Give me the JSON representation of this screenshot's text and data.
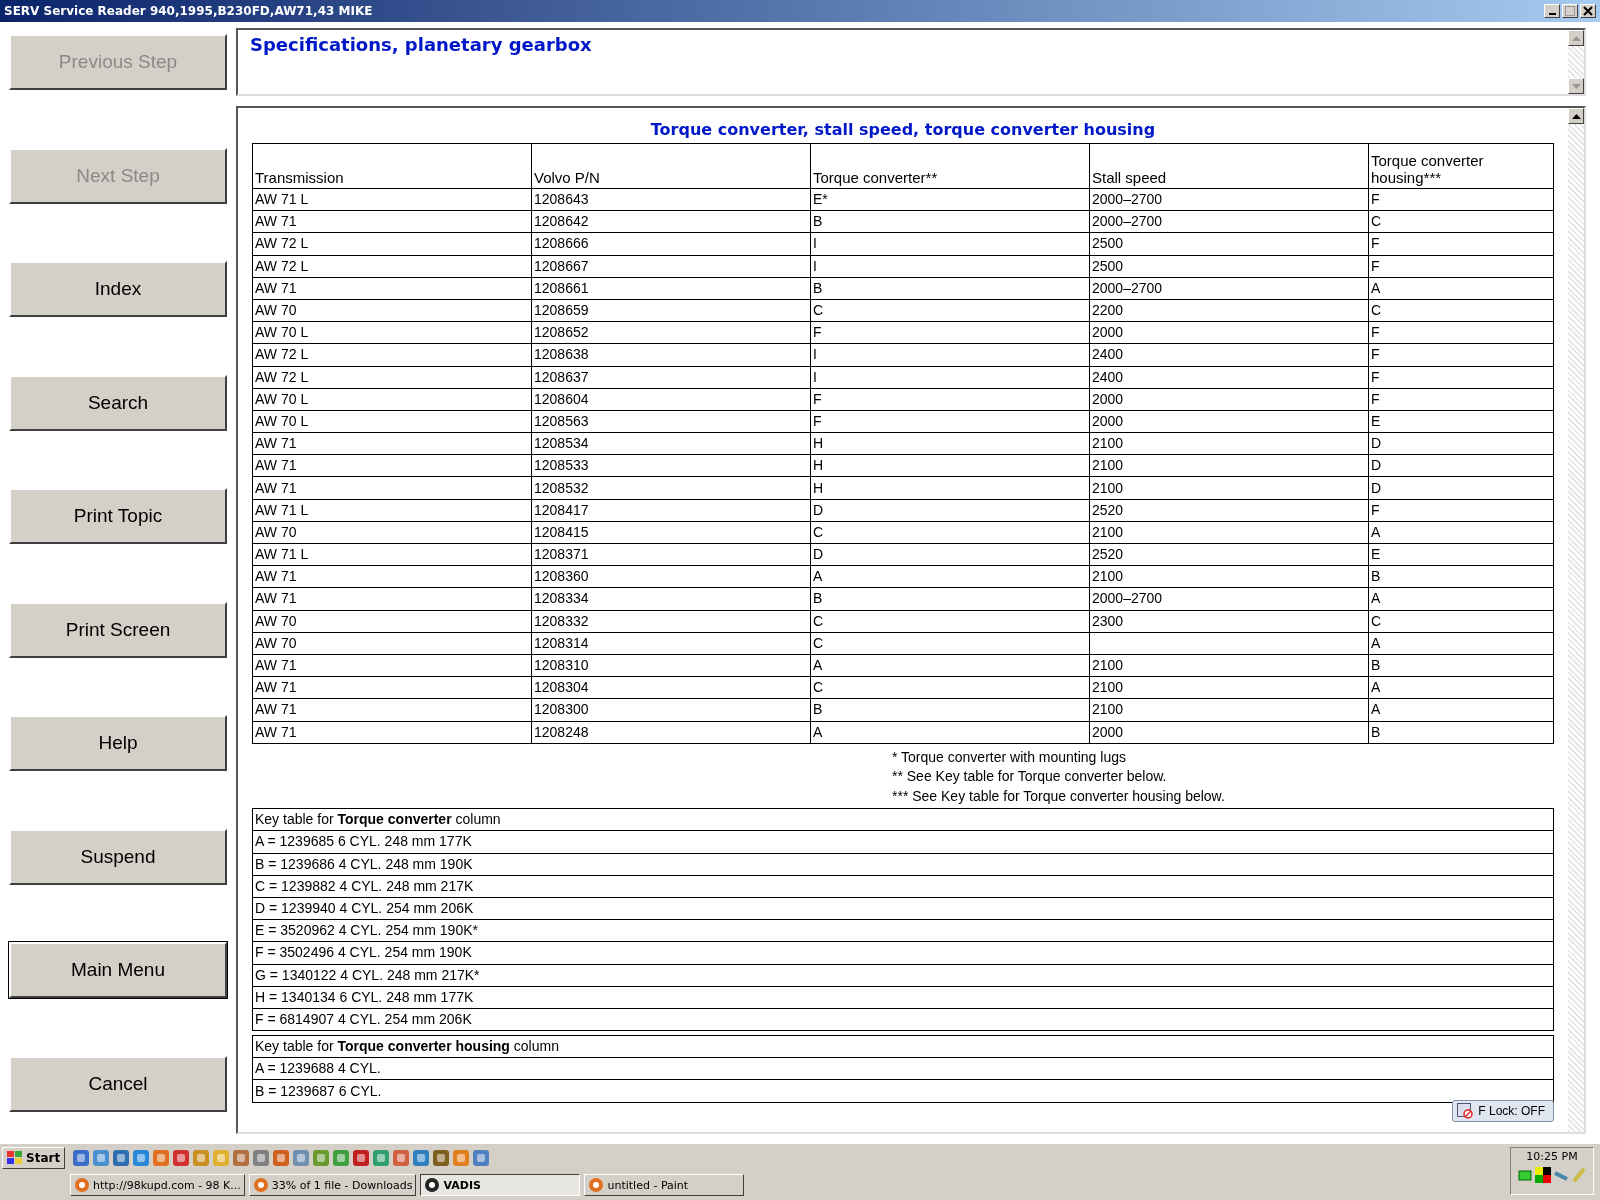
{
  "window": {
    "title": "SERV Service Reader 940,1995,B230FD,AW71,43 MIKE"
  },
  "sidebar": {
    "buttons": [
      {
        "label": "Previous Step",
        "disabled": true,
        "focused": false
      },
      {
        "label": "Next Step",
        "disabled": true,
        "focused": false
      },
      {
        "label": "Index",
        "disabled": false,
        "focused": false
      },
      {
        "label": "Search",
        "disabled": false,
        "focused": false
      },
      {
        "label": "Print Topic",
        "disabled": false,
        "focused": false
      },
      {
        "label": "Print Screen",
        "disabled": false,
        "focused": false
      },
      {
        "label": "Help",
        "disabled": false,
        "focused": false
      },
      {
        "label": "Suspend",
        "disabled": false,
        "focused": false
      },
      {
        "label": "Main Menu",
        "disabled": false,
        "focused": true
      },
      {
        "label": "Cancel",
        "disabled": false,
        "focused": false
      }
    ]
  },
  "topic": {
    "title": "Specifications, planetary gearbox"
  },
  "table": {
    "title": "Torque converter, stall speed, torque converter housing",
    "columns": [
      "Transmission",
      "Volvo P/N",
      "Torque converter**",
      "Stall speed",
      "Torque converter housing***"
    ],
    "rows": [
      [
        "AW 71 L",
        "1208643",
        "E*",
        "2000–2700",
        "F"
      ],
      [
        "AW 71",
        "1208642",
        "B",
        "2000–2700",
        "C"
      ],
      [
        "AW 72 L",
        "1208666",
        "I",
        "2500",
        "F"
      ],
      [
        "AW 72 L",
        "1208667",
        "I",
        "2500",
        "F"
      ],
      [
        "AW 71",
        "1208661",
        "B",
        "2000–2700",
        "A"
      ],
      [
        "AW 70",
        "1208659",
        "C",
        "2200",
        "C"
      ],
      [
        "AW 70 L",
        "1208652",
        "F",
        "2000",
        "F"
      ],
      [
        "AW 72 L",
        "1208638",
        "I",
        "2400",
        "F"
      ],
      [
        "AW 72 L",
        "1208637",
        "I",
        "2400",
        "F"
      ],
      [
        "AW 70 L",
        "1208604",
        "F",
        "2000",
        "F"
      ],
      [
        "AW 70 L",
        "1208563",
        "F",
        "2000",
        "E"
      ],
      [
        "AW 71",
        "1208534",
        "H",
        "2100",
        "D"
      ],
      [
        "AW 71",
        "1208533",
        "H",
        "2100",
        "D"
      ],
      [
        "AW 71",
        "1208532",
        "H",
        "2100",
        "D"
      ],
      [
        "AW 71 L",
        "1208417",
        "D",
        "2520",
        "F"
      ],
      [
        "AW 70",
        "1208415",
        "C",
        "2100",
        "A"
      ],
      [
        "AW 71 L",
        "1208371",
        "D",
        "2520",
        "E"
      ],
      [
        "AW 71",
        "1208360",
        "A",
        "2100",
        "B"
      ],
      [
        "AW 71",
        "1208334",
        "B",
        "2000–2700",
        "A"
      ],
      [
        "AW 70",
        "1208332",
        "C",
        "2300",
        "C"
      ],
      [
        "AW 70",
        "1208314",
        "C",
        null,
        "A"
      ],
      [
        "AW 71",
        "1208310",
        "A",
        "2100",
        "B"
      ],
      [
        "AW 71",
        "1208304",
        "C",
        "2100",
        "A"
      ],
      [
        "AW 71",
        "1208300",
        "B",
        "2100",
        "A"
      ],
      [
        "AW 71",
        "1208248",
        "A",
        "2000",
        "B"
      ]
    ]
  },
  "footnotes": [
    "* Torque converter with mounting lugs",
    "** See Key table for Torque converter below.",
    "*** See Key table for Torque converter housing below."
  ],
  "key_tables": [
    {
      "heading": "Key table for  **Torque converter**  column",
      "rows": [
        "A = 1239685 6 CYL. 248 mm 177K",
        "B = 1239686 4 CYL. 248 mm 190K",
        "C = 1239882 4 CYL. 248 mm 217K",
        "D = 1239940 4 CYL. 254 mm 206K",
        "E = 3520962 4 CYL. 254 mm 190K*",
        "F = 3502496 4 CYL. 254 mm 190K",
        "G = 1340122 4 CYL. 248 mm 217K*",
        "H = 1340134 6 CYL. 248 mm 177K",
        "F = 6814907 4 CYL. 254 mm 206K"
      ]
    },
    {
      "heading": "Key table for  **Torque converter housing**  column",
      "rows": [
        "A = 1239688 4 CYL.",
        "B = 1239687 6 CYL."
      ]
    }
  ],
  "notification": {
    "text": "F Lock: OFF"
  },
  "taskbar": {
    "start": "Start",
    "tasks": [
      {
        "label": "http://98kupd.com - 98 K...",
        "selected": false
      },
      {
        "label": "33% of 1 file - Downloads",
        "selected": false
      },
      {
        "label": "VADIS",
        "selected": true
      },
      {
        "label": "untitled - Paint",
        "selected": false
      }
    ],
    "clock": "10:25 PM"
  }
}
